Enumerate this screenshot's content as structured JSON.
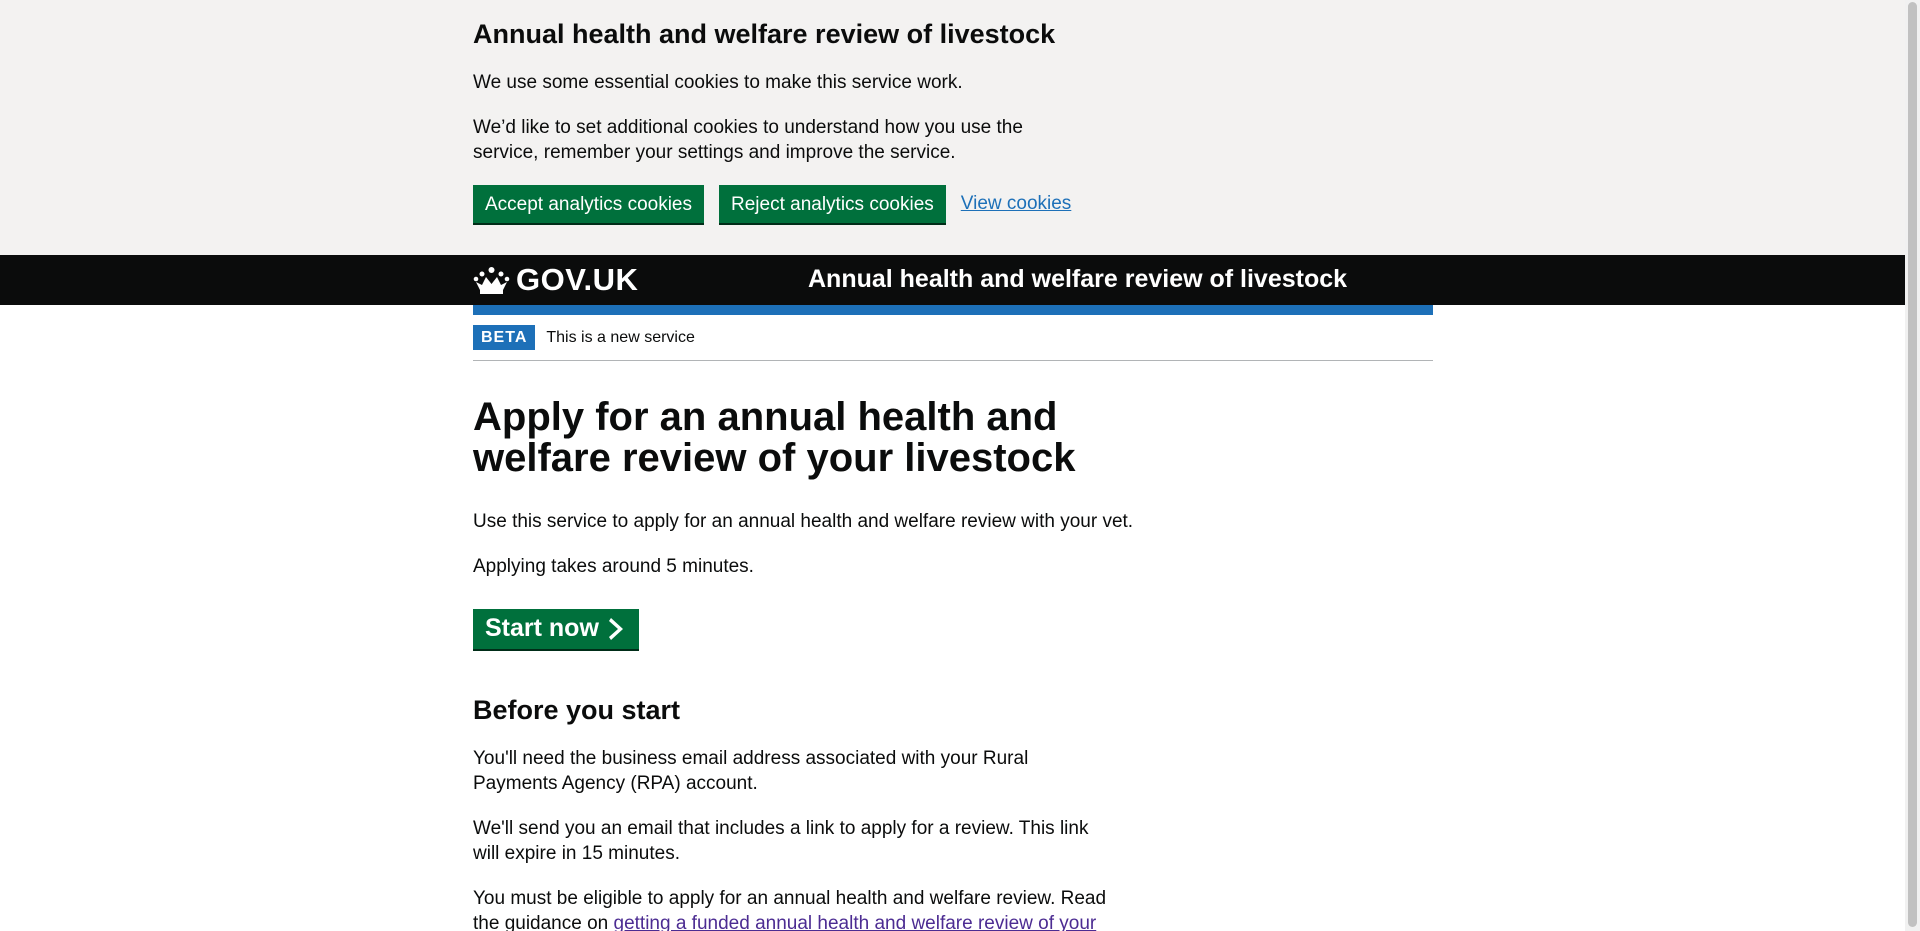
{
  "cookie_banner": {
    "heading": "Annual health and welfare review of livestock",
    "paragraph1": "We use some essential cookies to make this service work.",
    "paragraph2": "We’d like to set additional cookies to understand how you use the service, remember your settings and improve the service.",
    "accept_label": "Accept analytics cookies",
    "reject_label": "Reject analytics cookies",
    "view_label": "View cookies"
  },
  "header": {
    "logo_text": "GOV.UK",
    "logo_icon": "crown-icon",
    "service_name": "Annual health and welfare review of livestock"
  },
  "phase_banner": {
    "tag": "BETA",
    "text": "This is a new service"
  },
  "main": {
    "title": "Apply for an annual health and welfare review of your livestock",
    "intro1": "Use this service to apply for an annual health and welfare review with your vet.",
    "intro2": "Applying takes around 5 minutes.",
    "start_button": "Start now",
    "start_icon": "chevron-right-icon",
    "before_heading": "Before you start",
    "before_p1": "You'll need the business email address associated with your Rural Payments Agency (RPA) account.",
    "before_p2": "We'll send you an email that includes a link to apply for a review. This link will expire in 15 minutes.",
    "before_p3_start": "You must be eligible to apply for an annual health and welfare review. Read the guidance on ",
    "before_p3_link": "getting a funded annual health and welfare review of your"
  },
  "colors": {
    "primary_button": "#00703c",
    "header_bg": "#0b0c0c",
    "brand_blue": "#1d70b8",
    "banner_bg": "#f3f2f1",
    "visited_link": "#4c2c92"
  }
}
